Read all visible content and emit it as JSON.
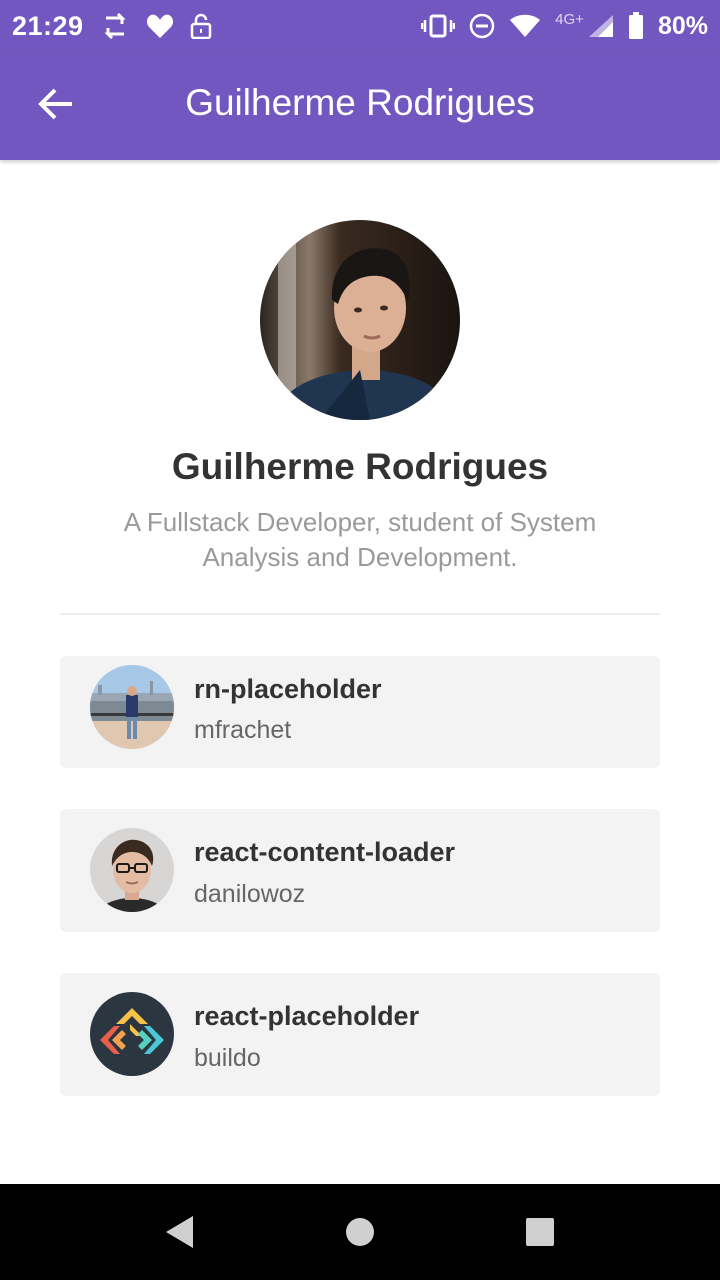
{
  "status_bar": {
    "time": "21:29",
    "network": "4G+",
    "battery": "80%",
    "icons_left": [
      "sync-icon",
      "heart-icon",
      "unlock-icon"
    ],
    "icons_right": [
      "vibrate-icon",
      "do-not-disturb-icon",
      "wifi-icon",
      "signal-icon",
      "battery-icon"
    ]
  },
  "app_bar": {
    "title": "Guilherme Rodrigues",
    "back_icon": "arrow-left-icon",
    "color": "#7357c0"
  },
  "profile": {
    "name": "Guilherme Rodrigues",
    "bio": "A Fullstack Developer, student of System Analysis and Development."
  },
  "repos": [
    {
      "name": "rn-placeholder",
      "owner": "mfrachet"
    },
    {
      "name": "react-content-loader",
      "owner": "danilowoz"
    },
    {
      "name": "react-placeholder",
      "owner": "buildo"
    }
  ],
  "nav_bar": {
    "back": "back-triangle-icon",
    "home": "home-circle-icon",
    "recents": "recents-square-icon"
  },
  "colors": {
    "accent": "#7357c0",
    "card_bg": "#f3f3f3",
    "text_primary": "#333333",
    "text_secondary": "#9a9a9a"
  }
}
